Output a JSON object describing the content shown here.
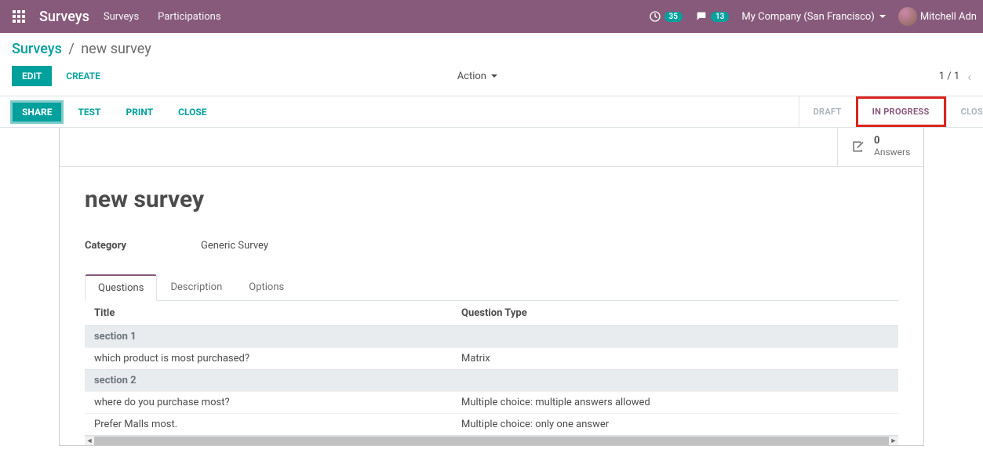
{
  "topnav": {
    "brand": "Surveys",
    "links": [
      "Surveys",
      "Participations"
    ],
    "clock_badge": "35",
    "chat_badge": "13",
    "company": "My Company (San Francisco)",
    "user": "Mitchell Adn"
  },
  "breadcrumb": {
    "root": "Surveys",
    "current": "new survey"
  },
  "buttons": {
    "edit": "Edit",
    "create": "Create",
    "action": "Action",
    "share": "SHARE",
    "test": "TEST",
    "print": "PRINT",
    "close": "CLOSE"
  },
  "pager": {
    "range": "1 / 1"
  },
  "status_steps": {
    "draft": "DRAFT",
    "in_progress": "IN PROGRESS",
    "closed": "CLOS"
  },
  "answers_btn": {
    "count": "0",
    "label": "Answers"
  },
  "survey": {
    "title": "new survey",
    "category_label": "Category",
    "category_value": "Generic Survey"
  },
  "tabs": {
    "questions": "Questions",
    "description": "Description",
    "options": "Options"
  },
  "qtable": {
    "col_title": "Title",
    "col_type": "Question Type",
    "rows": [
      {
        "kind": "section",
        "title": "section 1"
      },
      {
        "kind": "q",
        "title": "which product is most purchased?",
        "type": "Matrix"
      },
      {
        "kind": "section",
        "title": "section 2"
      },
      {
        "kind": "q",
        "title": "where do you purchase most?",
        "type": "Multiple choice: multiple answers allowed"
      },
      {
        "kind": "q",
        "title": "Prefer Malls most.",
        "type": "Multiple choice: only one answer"
      }
    ]
  }
}
